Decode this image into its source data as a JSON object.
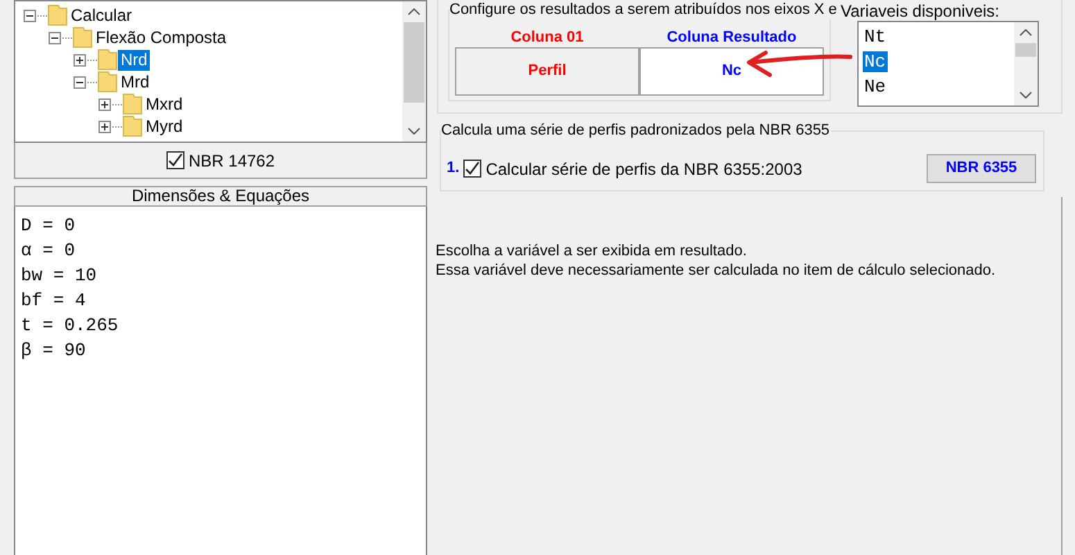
{
  "tree": {
    "items": [
      {
        "label": "Calcular",
        "expanded": true,
        "selected": false,
        "children": [
          {
            "label": "Flexão Composta",
            "expanded": true,
            "selected": false,
            "children": [
              {
                "label": "Nrd",
                "expanded": false,
                "selected": true
              },
              {
                "label": "Mrd",
                "expanded": true,
                "selected": false,
                "children": [
                  {
                    "label": "Mxrd",
                    "expanded": false,
                    "selected": false
                  },
                  {
                    "label": "Myrd",
                    "expanded": false,
                    "selected": false
                  }
                ]
              }
            ]
          }
        ]
      }
    ]
  },
  "norm_checkbox": {
    "label": "NBR 14762",
    "checked": true
  },
  "equations": {
    "title": "Dimensões & Equações",
    "lines": [
      "D = 0",
      "α = 0",
      "bw = 10",
      "bf = 4",
      "t = 0.265",
      "β = 90"
    ]
  },
  "result_config": {
    "legend": "Configure os resultados a serem atribuídos nos eixos X e",
    "columns": [
      {
        "header": "Coluna 01",
        "value": "Perfil",
        "color": "#ff0000",
        "selected": false
      },
      {
        "header": "Coluna Resultado",
        "value": "Nc",
        "color": "#0000ff",
        "selected": true
      }
    ]
  },
  "variables": {
    "label": "Variaveis disponiveis:",
    "items": [
      {
        "label": "Nt",
        "selected": false
      },
      {
        "label": "Nc",
        "selected": true
      },
      {
        "label": "Ne",
        "selected": false
      }
    ]
  },
  "series": {
    "legend": "Calcula uma série de perfis padronizados pela NBR 6355",
    "number": "1.",
    "checkbox": {
      "label": "Calcular série de perfis da NBR 6355:2003",
      "checked": true
    },
    "button": "NBR 6355"
  },
  "message": {
    "lines": [
      "Escolha a variável a ser exibida em resultado.",
      "Essa variável deve necessariamente ser calculada no item de cálculo selecionado."
    ]
  }
}
